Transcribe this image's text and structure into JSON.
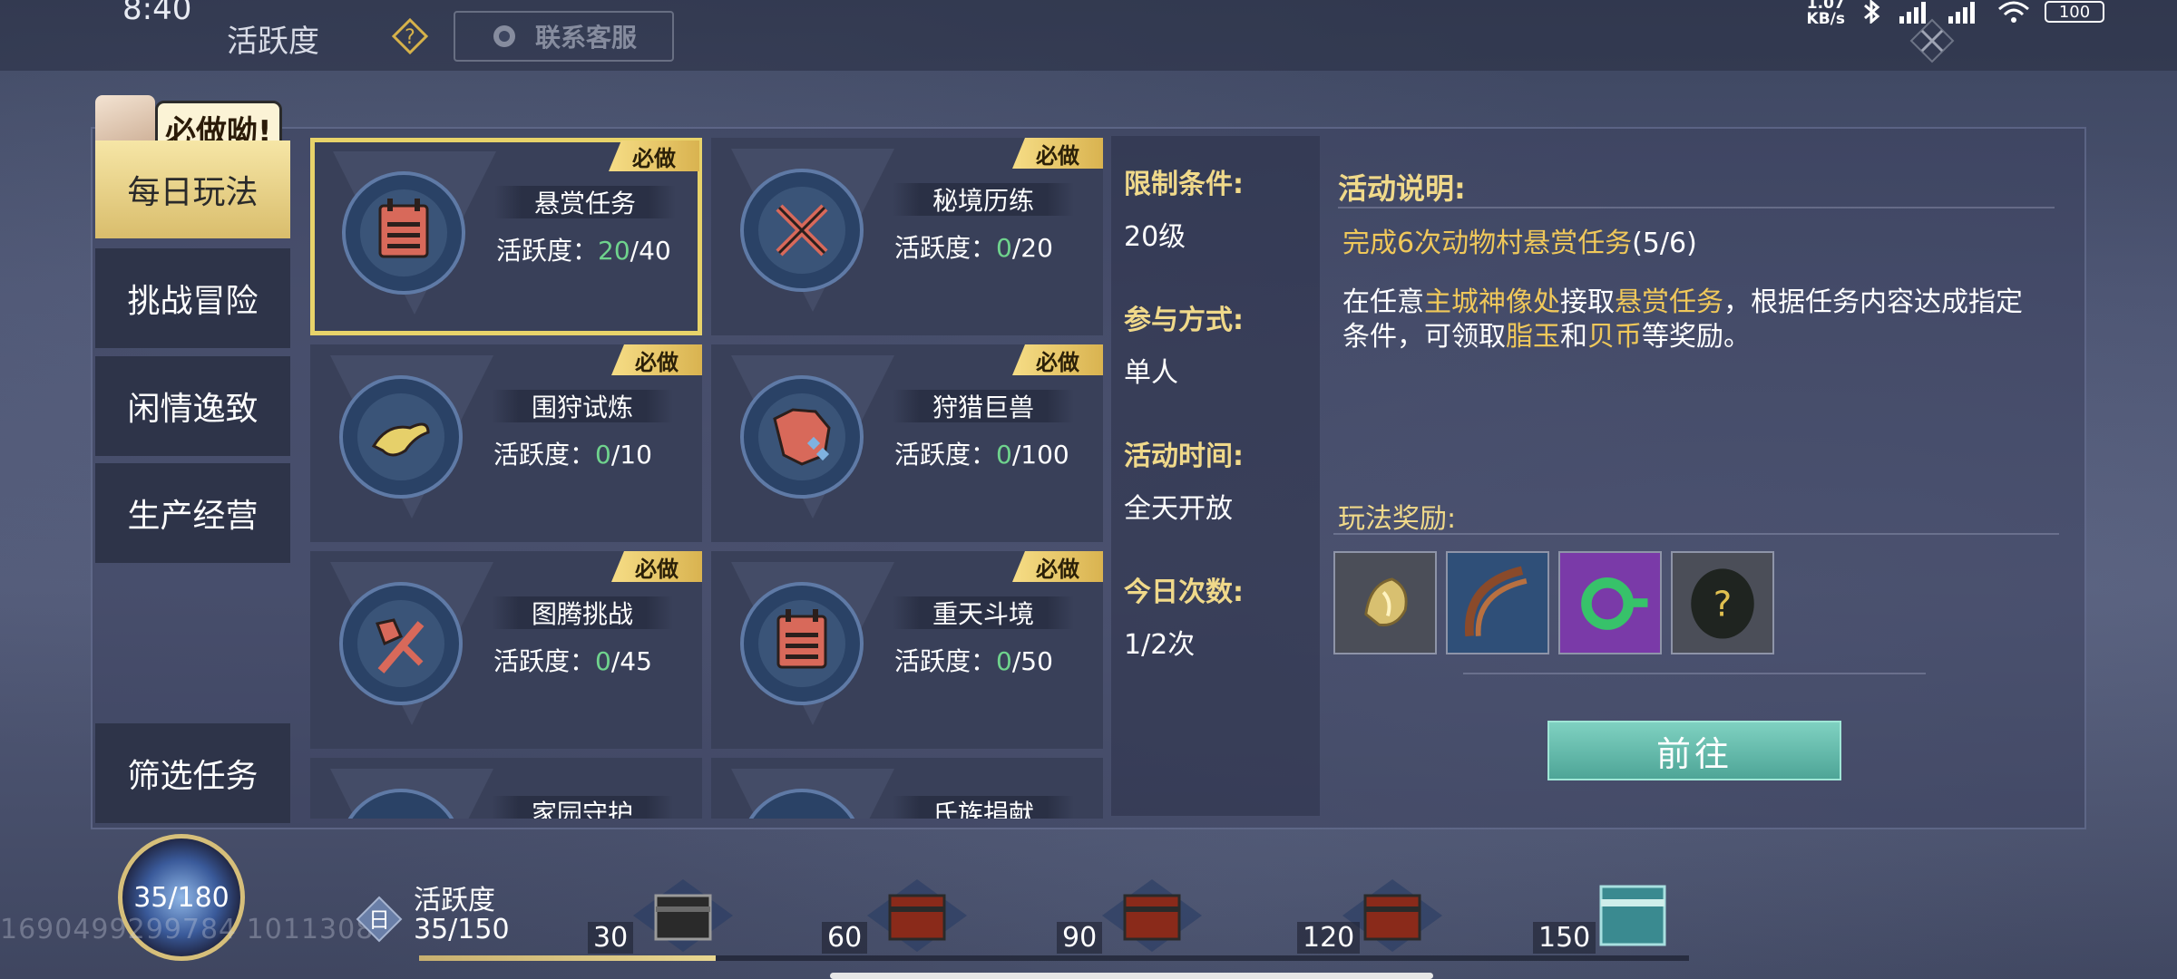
{
  "status_bar": {
    "time": "8:40",
    "net_speed_top": "1.07",
    "net_speed_unit": "KB/s",
    "battery": "100"
  },
  "header": {
    "title": "活跃度",
    "help_icon": "question-diamond-icon",
    "service_label": "联系客服"
  },
  "mascot_bubble": "必做呦!",
  "nav": {
    "items": [
      {
        "label": "每日玩法",
        "active": true
      },
      {
        "label": "挑战冒险",
        "active": false
      },
      {
        "label": "闲情逸致",
        "active": false
      },
      {
        "label": "生产经营",
        "active": false
      }
    ],
    "filter_label": "筛选任务"
  },
  "cards": [
    {
      "name": "悬赏任务",
      "tag": "必做",
      "score_label": "活跃度：",
      "current": "20",
      "max": "/40",
      "icon": "calendar-icon",
      "selected": true
    },
    {
      "name": "秘境历练",
      "tag": "必做",
      "score_label": "活跃度：",
      "current": "0",
      "max": "/20",
      "icon": "crossed-swords-icon",
      "selected": false
    },
    {
      "name": "围狩试炼",
      "tag": "必做",
      "score_label": "活跃度：",
      "current": "0",
      "max": "/10",
      "icon": "dragon-icon",
      "selected": false
    },
    {
      "name": "狩猎巨兽",
      "tag": "必做",
      "score_label": "活跃度：",
      "current": "0",
      "max": "/100",
      "icon": "beast-icon",
      "selected": false
    },
    {
      "name": "图腾挑战",
      "tag": "必做",
      "score_label": "活跃度：",
      "current": "0",
      "max": "/45",
      "icon": "axe-icon",
      "selected": false
    },
    {
      "name": "重天斗境",
      "tag": "必做",
      "score_label": "活跃度：",
      "current": "0",
      "max": "/50",
      "icon": "calendar-icon",
      "selected": false
    },
    {
      "name": "家园守护"
    },
    {
      "name": "氏族捐献"
    }
  ],
  "conditions": {
    "limit_label": "限制条件:",
    "limit_value": "20级",
    "mode_label": "参与方式:",
    "mode_value": "单人",
    "time_label": "活动时间:",
    "time_value": "全天开放",
    "count_label": "今日次数:",
    "count_value": "1/2次"
  },
  "description": {
    "title": "活动说明:",
    "task_text": "完成6次动物村悬赏任务",
    "task_progress": "(5/6)",
    "body_1": "在任意",
    "body_hl_1": "主城神像处",
    "body_2": "接取",
    "body_hl_2": "悬赏任务",
    "body_3": "，根据任务内容达成指定条件，可领取",
    "body_hl_3": "脂玉",
    "body_4": "和",
    "body_hl_4": "贝币",
    "body_5": "等奖励。"
  },
  "rewards": {
    "title": "玩法奖励:",
    "items": [
      "gold-jade-icon",
      "brown-feather-icon",
      "green-ring-icon",
      "mystery-item-icon"
    ]
  },
  "go_button": "前往",
  "bottom": {
    "orb_text": "35/180",
    "watermark": "1690499299784 1011308",
    "activity_icon_char": "日",
    "activity_label": "活跃度",
    "activity_value": "35/150",
    "progress_fraction": 0.2333,
    "milestones": [
      "30",
      "60",
      "90",
      "120",
      "150"
    ]
  }
}
